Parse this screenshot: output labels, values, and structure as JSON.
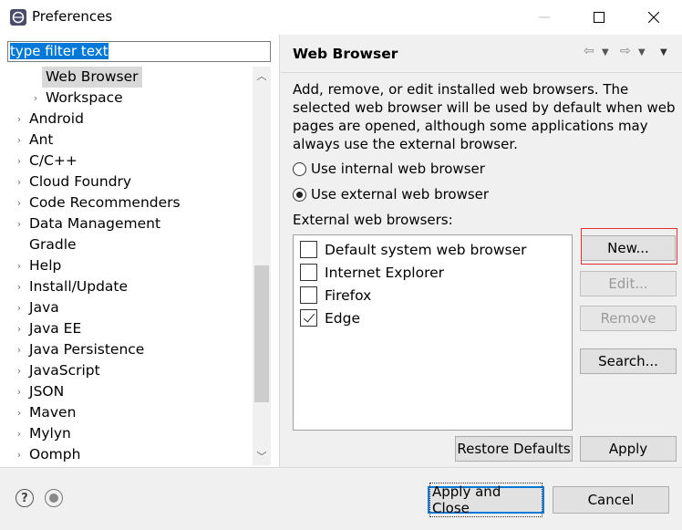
{
  "window": {
    "title": "Preferences",
    "minimize": "—",
    "maximize": "☐",
    "close": "✕"
  },
  "filter": {
    "value": "type filter text"
  },
  "tree": [
    {
      "label": "Web Browser",
      "indent": 2,
      "arrow": "",
      "selected": true
    },
    {
      "label": "Workspace",
      "indent": 2,
      "arrow": "›"
    },
    {
      "label": "Android",
      "indent": 1,
      "arrow": "›"
    },
    {
      "label": "Ant",
      "indent": 1,
      "arrow": "›"
    },
    {
      "label": "C/C++",
      "indent": 1,
      "arrow": "›"
    },
    {
      "label": "Cloud Foundry",
      "indent": 1,
      "arrow": "›"
    },
    {
      "label": "Code Recommenders",
      "indent": 1,
      "arrow": "›"
    },
    {
      "label": "Data Management",
      "indent": 1,
      "arrow": "›"
    },
    {
      "label": "Gradle",
      "indent": 1,
      "arrow": ""
    },
    {
      "label": "Help",
      "indent": 1,
      "arrow": "›"
    },
    {
      "label": "Install/Update",
      "indent": 1,
      "arrow": "›"
    },
    {
      "label": "Java",
      "indent": 1,
      "arrow": "›"
    },
    {
      "label": "Java EE",
      "indent": 1,
      "arrow": "›"
    },
    {
      "label": "Java Persistence",
      "indent": 1,
      "arrow": "›"
    },
    {
      "label": "JavaScript",
      "indent": 1,
      "arrow": "›"
    },
    {
      "label": "JSON",
      "indent": 1,
      "arrow": "›"
    },
    {
      "label": "Maven",
      "indent": 1,
      "arrow": "›"
    },
    {
      "label": "Mylyn",
      "indent": 1,
      "arrow": "›"
    },
    {
      "label": "Oomph",
      "indent": 1,
      "arrow": "›"
    }
  ],
  "page": {
    "title": "Web Browser",
    "description": "Add, remove, or edit installed web browsers. The selected web browser will be used by default when web pages are opened, although some applications may always use the external browser.",
    "internal_label": "Use internal web browser",
    "external_label": "Use external web browser",
    "internal_selected": false,
    "external_selected": true,
    "list_label": "External web browsers:",
    "browsers": [
      {
        "name": "Default system web browser",
        "checked": false
      },
      {
        "name": "Internet Explorer",
        "checked": false
      },
      {
        "name": "Firefox",
        "checked": false
      },
      {
        "name": "Edge",
        "checked": true
      }
    ],
    "buttons": {
      "new": "New...",
      "edit": "Edit...",
      "remove": "Remove",
      "search": "Search...",
      "restore": "Restore Defaults",
      "apply": "Apply"
    }
  },
  "footer": {
    "help": "?",
    "apply_close": "Apply and Close",
    "cancel": "Cancel"
  }
}
